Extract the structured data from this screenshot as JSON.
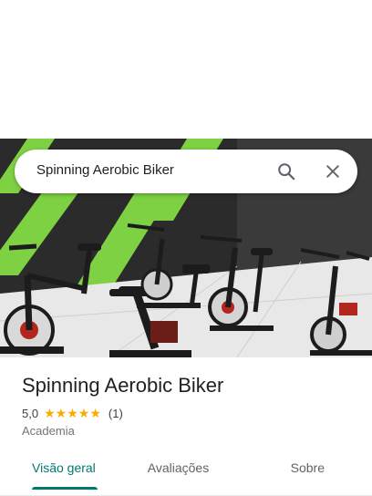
{
  "search": {
    "query": "Spinning Aerobic Biker",
    "search_icon": "search-icon",
    "close_icon": "close-icon"
  },
  "hero": {
    "photo": "gym-spinning-bikes-photo",
    "colors": {
      "stripe": "#7dd143",
      "wall": "#2b2b2b",
      "floor": "#e9e9e9",
      "bike": "#1c1c1c",
      "accent": "#b3261e"
    }
  },
  "place": {
    "title": "Spinning Aerobic Biker",
    "rating": "5,0",
    "stars": 5,
    "star_glyphs": [
      "★",
      "★",
      "★",
      "★",
      "★"
    ],
    "review_count": "(1)",
    "category": "Academia"
  },
  "tabs": [
    {
      "label": "Visão geral",
      "active": true
    },
    {
      "label": "Avaliações",
      "active": false
    },
    {
      "label": "Sobre",
      "active": false
    }
  ],
  "colors": {
    "accent": "#01796f",
    "star": "#f9ab00"
  }
}
